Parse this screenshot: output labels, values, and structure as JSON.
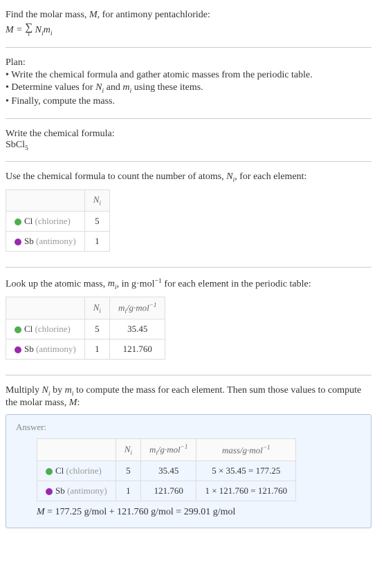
{
  "intro": {
    "line1_prefix": "Find the molar mass, ",
    "line1_M": "M",
    "line1_suffix": ", for antimony pentachloride:",
    "formula_lhs": "M",
    "formula_eq": " = ",
    "formula_sigma_sub": "i",
    "formula_rhs_N": "N",
    "formula_rhs_m": "m"
  },
  "plan": {
    "title": "Plan:",
    "b1": "• Write the chemical formula and gather atomic masses from the periodic table.",
    "b2_prefix": "• Determine values for ",
    "b2_mid": " and ",
    "b2_suffix": " using these items.",
    "b3": "• Finally, compute the mass."
  },
  "formula_section": {
    "title": "Write the chemical formula:",
    "compound_base": "SbCl",
    "compound_sub": "5"
  },
  "count_section": {
    "text_prefix": "Use the chemical formula to count the number of atoms, ",
    "text_suffix": ", for each element:",
    "table": {
      "h_N": "N",
      "h_i": "i",
      "rows": [
        {
          "el": "Cl",
          "elgray": "(chlorine)",
          "n": "5",
          "dot": "dot-cl"
        },
        {
          "el": "Sb",
          "elgray": "(antimony)",
          "n": "1",
          "dot": "dot-sb"
        }
      ]
    }
  },
  "mass_section": {
    "text_prefix": "Look up the atomic mass, ",
    "text_mid": ", in g·mol",
    "text_sup": "−1",
    "text_suffix": " for each element in the periodic table:",
    "table": {
      "h_N": "N",
      "h_i": "i",
      "h_m": "m",
      "h_unit_pre": "/g·mol",
      "h_unit_sup": "−1",
      "rows": [
        {
          "el": "Cl",
          "elgray": "(chlorine)",
          "n": "5",
          "m": "35.45",
          "dot": "dot-cl"
        },
        {
          "el": "Sb",
          "elgray": "(antimony)",
          "n": "1",
          "m": "121.760",
          "dot": "dot-sb"
        }
      ]
    }
  },
  "multiply_section": {
    "p1": "Multiply ",
    "p2": " by ",
    "p3": " to compute the mass for each element. Then sum those values to compute the molar mass, ",
    "p4": ":"
  },
  "answer": {
    "label": "Answer:",
    "table": {
      "h_N": "N",
      "h_i": "i",
      "h_m": "m",
      "h_unit_pre": "/g·mol",
      "h_unit_sup": "−1",
      "h_mass_pre": "mass/g·mol",
      "rows": [
        {
          "el": "Cl",
          "elgray": "(chlorine)",
          "n": "5",
          "m": "35.45",
          "calc": "5 × 35.45 = 177.25",
          "dot": "dot-cl"
        },
        {
          "el": "Sb",
          "elgray": "(antimony)",
          "n": "1",
          "m": "121.760",
          "calc": "1 × 121.760 = 121.760",
          "dot": "dot-sb"
        }
      ]
    },
    "final_lhs": "M",
    "final_rhs": " = 177.25 g/mol + 121.760 g/mol = 299.01 g/mol"
  }
}
